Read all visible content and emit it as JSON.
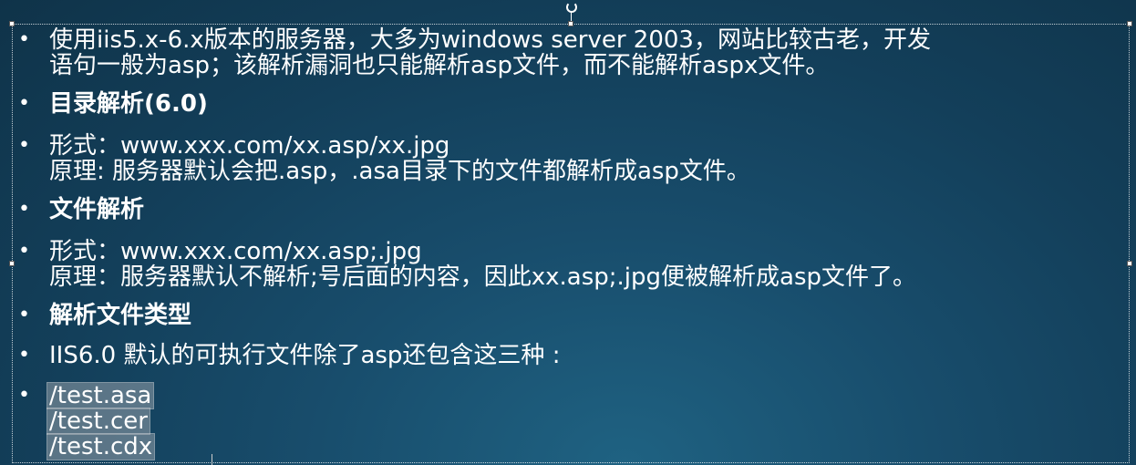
{
  "slide": {
    "items": [
      {
        "lines": [
          "使用iis5.x-6.x版本的服务器，大多为windows server 2003，网站比较古老，开发",
          "语句一般为asp；该解析漏洞也只能解析asp文件，而不能解析aspx文件。"
        ]
      },
      {
        "lines": [
          "目录解析(6.0)"
        ],
        "bold": true
      },
      {
        "lines": [
          "形式：www.xxx.com/xx.asp/xx.jpg",
          "原理: 服务器默认会把.asp，.asa目录下的文件都解析成asp文件。"
        ]
      },
      {
        "lines": [
          "文件解析"
        ],
        "bold": true
      },
      {
        "lines": [
          "形式：www.xxx.com/xx.asp;.jpg",
          "原理：服务器默认不解析;号后面的内容，因此xx.asp;.jpg便被解析成asp文件了。"
        ]
      },
      {
        "lines": [
          "解析文件类型"
        ],
        "bold": true
      },
      {
        "lines": [
          "IIS6.0 默认的可执行文件除了asp还包含这三种 :"
        ]
      }
    ],
    "selected_lines": [
      "/test.asa",
      "/test.cer",
      "/test.cdx"
    ]
  }
}
